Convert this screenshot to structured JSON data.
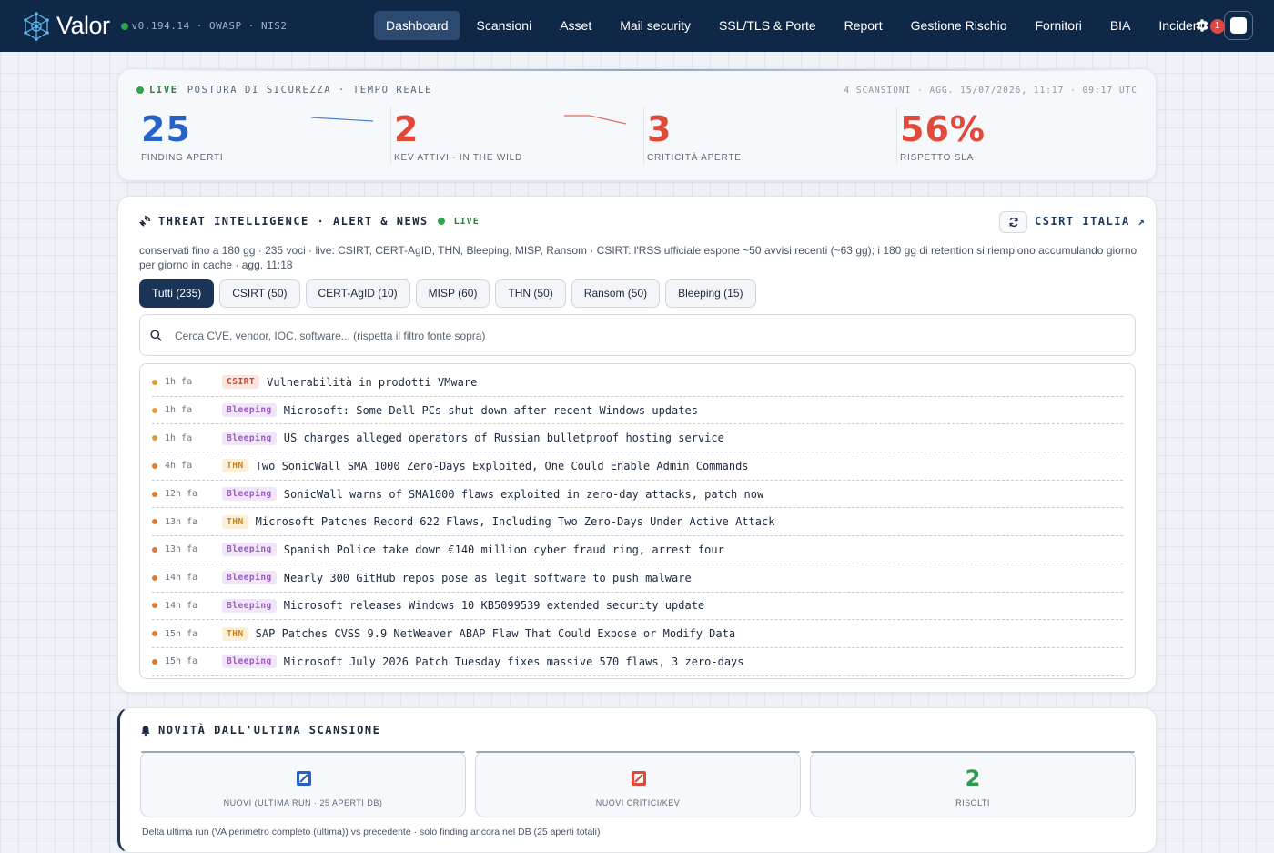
{
  "nav": {
    "brand": "Valor",
    "version": "v0.194.14 · OWASP · NIS2",
    "items": [
      {
        "label": "Dashboard",
        "active": true
      },
      {
        "label": "Scansioni"
      },
      {
        "label": "Asset"
      },
      {
        "label": "Mail security"
      },
      {
        "label": "SSL/TLS & Porte"
      },
      {
        "label": "Report"
      },
      {
        "label": "Gestione Rischio"
      },
      {
        "label": "Fornitori"
      },
      {
        "label": "BIA"
      }
    ],
    "incidents_label": "Incidenti",
    "incidents_count": "1",
    "icons": [
      "valor-logo-icon",
      "gear-icon",
      "avatar"
    ]
  },
  "posture": {
    "live_label": "LIVE",
    "title": "POSTURA DI SICUREZZA · TEMPO REALE",
    "meta": "4 SCANSIONI · AGG. 15/07/2026, 11:17 · 09:17 UTC",
    "kpis": [
      {
        "value": "25",
        "label": "FINDING APERTI",
        "color": "#2563c9"
      },
      {
        "value": "2",
        "label": "KEV ATTIVI · IN THE WILD",
        "color": "#e04a3a"
      },
      {
        "value": "3",
        "label": "CRITICITÀ APERTE",
        "color": "#e04a3a"
      },
      {
        "value": "56%",
        "label": "RISPETTO SLA",
        "color": "#e04a3a"
      }
    ]
  },
  "threat": {
    "title": "THREAT INTELLIGENCE · ALERT & NEWS",
    "live_label": "LIVE",
    "link_label": "CSIRT ITALIA ↗",
    "description": "conservati fino a 180 gg · 235 voci · live: CSIRT, CERT-AgID, THN, Bleeping, MISP, Ransom · CSIRT: l'RSS ufficiale espone ~50 avvisi recenti (~63 gg); i 180 gg di retention si riempiono accumulando giorno per giorno in cache · agg. 11:18",
    "filters": [
      {
        "label": "Tutti (235)",
        "active": true
      },
      {
        "label": "CSIRT (50)"
      },
      {
        "label": "CERT-AgID (10)"
      },
      {
        "label": "MISP (60)"
      },
      {
        "label": "THN (50)"
      },
      {
        "label": "Ransom (50)"
      },
      {
        "label": "Bleeping (15)"
      }
    ],
    "search_placeholder": "Cerca CVE, vendor, IOC, software... (rispetta il filtro fonte sopra)",
    "source_colors": {
      "CSIRT": {
        "bg": "#fbe5e1",
        "fg": "#c9492f"
      },
      "Bleeping": {
        "bg": "#f1e6f7",
        "fg": "#9a5bc0"
      },
      "THN": {
        "bg": "#fcefd8",
        "fg": "#c98320"
      }
    },
    "feed": [
      {
        "time": "1h fa",
        "source": "CSIRT",
        "title": "Vulnerabilità in prodotti VMware",
        "dot": "#e0a030"
      },
      {
        "time": "1h fa",
        "source": "Bleeping",
        "title": "Microsoft: Some Dell PCs shut down after recent Windows updates",
        "dot": "#e0a030"
      },
      {
        "time": "1h fa",
        "source": "Bleeping",
        "title": "US charges alleged operators of Russian bulletproof hosting service",
        "dot": "#e0a030"
      },
      {
        "time": "4h fa",
        "source": "THN",
        "title": "Two SonicWall SMA 1000 Zero-Days Exploited, One Could Enable Admin Commands",
        "dot": "#e07a30"
      },
      {
        "time": "12h fa",
        "source": "Bleeping",
        "title": "SonicWall warns of SMA1000 flaws exploited in zero-day attacks, patch now",
        "dot": "#e07a30"
      },
      {
        "time": "13h fa",
        "source": "THN",
        "title": "Microsoft Patches Record 622 Flaws, Including Two Zero-Days Under Active Attack",
        "dot": "#e07a30"
      },
      {
        "time": "13h fa",
        "source": "Bleeping",
        "title": "Spanish Police take down €140 million cyber fraud ring, arrest four",
        "dot": "#e07a30"
      },
      {
        "time": "14h fa",
        "source": "Bleeping",
        "title": "Nearly 300 GitHub repos pose as legit software to push malware",
        "dot": "#e07a30"
      },
      {
        "time": "14h fa",
        "source": "Bleeping",
        "title": "Microsoft releases Windows 10 KB5099539 extended security update",
        "dot": "#e07a30"
      },
      {
        "time": "15h fa",
        "source": "THN",
        "title": "SAP Patches CVSS 9.9 NetWeaver ABAP Flaw That Could Expose or Modify Data",
        "dot": "#e07a30"
      },
      {
        "time": "15h fa",
        "source": "Bleeping",
        "title": "Microsoft July 2026 Patch Tuesday fixes massive 570 flaws, 3 zero-days",
        "dot": "#e07a30"
      }
    ]
  },
  "novita": {
    "title": "NOVITÀ DALL'ULTIMA SCANSIONE",
    "boxes": [
      {
        "icon": "zero-blue-icon",
        "label": "NUOVI (ULTIMA RUN · 25 APERTI DB)"
      },
      {
        "icon": "zero-red-icon",
        "label": "NUOVI CRITICI/KEV"
      },
      {
        "value": "2",
        "label": "RISOLTI"
      }
    ],
    "footer": "Delta ultima run (VA perimetro completo (ultima)) vs precedente · solo finding ancora nel DB (25 aperti totali)"
  }
}
